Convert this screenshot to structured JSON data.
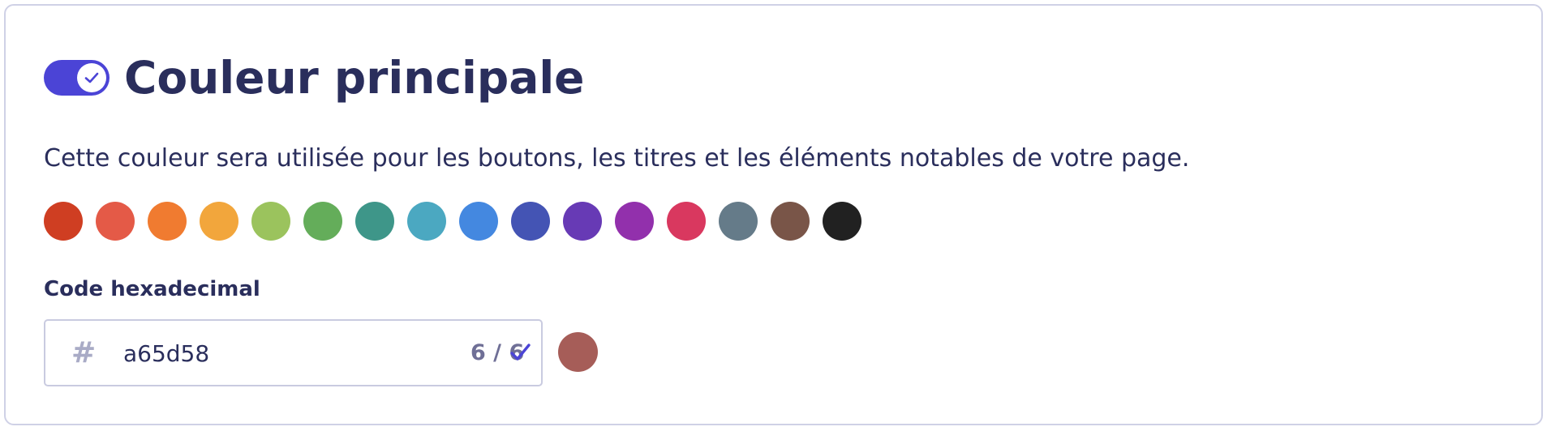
{
  "section": {
    "title": "Couleur principale",
    "description": "Cette couleur sera utilisée pour les boutons, les titres et les éléments notables de votre page.",
    "toggle_on": true
  },
  "palette": [
    "#cf3e22",
    "#e45a47",
    "#f07b30",
    "#f2a63c",
    "#9bc35d",
    "#64ad5a",
    "#3e9689",
    "#4ba8c1",
    "#4488e0",
    "#4454b4",
    "#673ab5",
    "#9230ac",
    "#d9385f",
    "#657b89",
    "#795548",
    "#212121"
  ],
  "hex_field": {
    "label": "Code hexadecimal",
    "prefix": "#",
    "value": "a65d58",
    "counter": "6 / 6"
  },
  "preview_color": "#a65d58",
  "colors": {
    "accent": "#4b44d6",
    "text": "#2a2e5c"
  }
}
